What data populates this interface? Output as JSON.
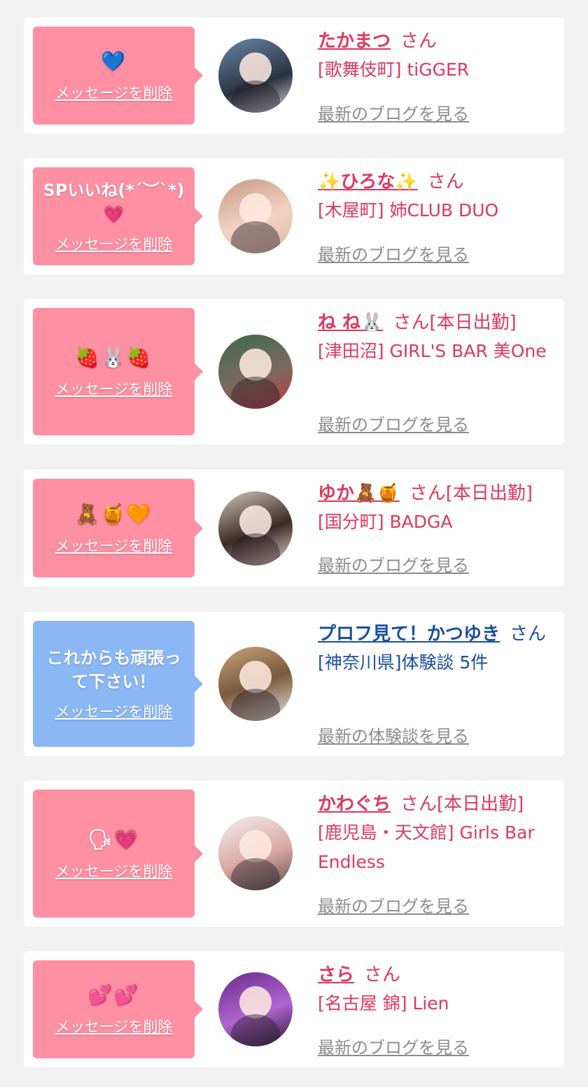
{
  "delete_label": "メッセージを削除",
  "colors": {
    "pink": "#ff8fa2",
    "blue": "#8bb8f4",
    "name_pink": "#e0375e",
    "name_blue": "#1a4fa0"
  },
  "entries": [
    {
      "message": "💙",
      "name": "たかまつ",
      "honorific": "さん",
      "attendance": "",
      "shop": "[歌舞伎町] tiGGER",
      "link": "最新のブログを見る"
    },
    {
      "message": "SPいいね(*´︶`*)💗",
      "name": "✨ひろな✨",
      "honorific": "さん",
      "attendance": "",
      "shop": "[木屋町] 姉CLUB DUO",
      "link": "最新のブログを見る"
    },
    {
      "message": "🍓🐰🍓",
      "name": "ね ね🐰",
      "honorific": "さん",
      "attendance": "[本日出勤]",
      "shop": "[津田沼] GIRL'S BAR 美One",
      "link": "最新のブログを見る"
    },
    {
      "message": "🧸🍯🧡",
      "name": "ゆか🧸🍯",
      "honorific": "さん",
      "attendance": "[本日出勤]",
      "shop": "[国分町] BADGA",
      "link": "最新のブログを見る"
    },
    {
      "message": "これからも頑張って下さい！",
      "name": "プロフ見て！かつゆき",
      "honorific": "さん",
      "attendance": "",
      "shop": "[神奈川県]体験談 5件",
      "link": "最新の体験談を見る"
    },
    {
      "message": "🗣💗",
      "name": "かわぐち",
      "honorific": "さん",
      "attendance": "[本日出勤]",
      "shop": "[鹿児島・天文館] Girls Bar Endless",
      "link": "最新のブログを見る"
    },
    {
      "message": "💕💕",
      "name": "さら",
      "honorific": "さん",
      "attendance": "",
      "shop": "[名古屋 錦] Lien",
      "link": "最新のブログを見る"
    }
  ]
}
